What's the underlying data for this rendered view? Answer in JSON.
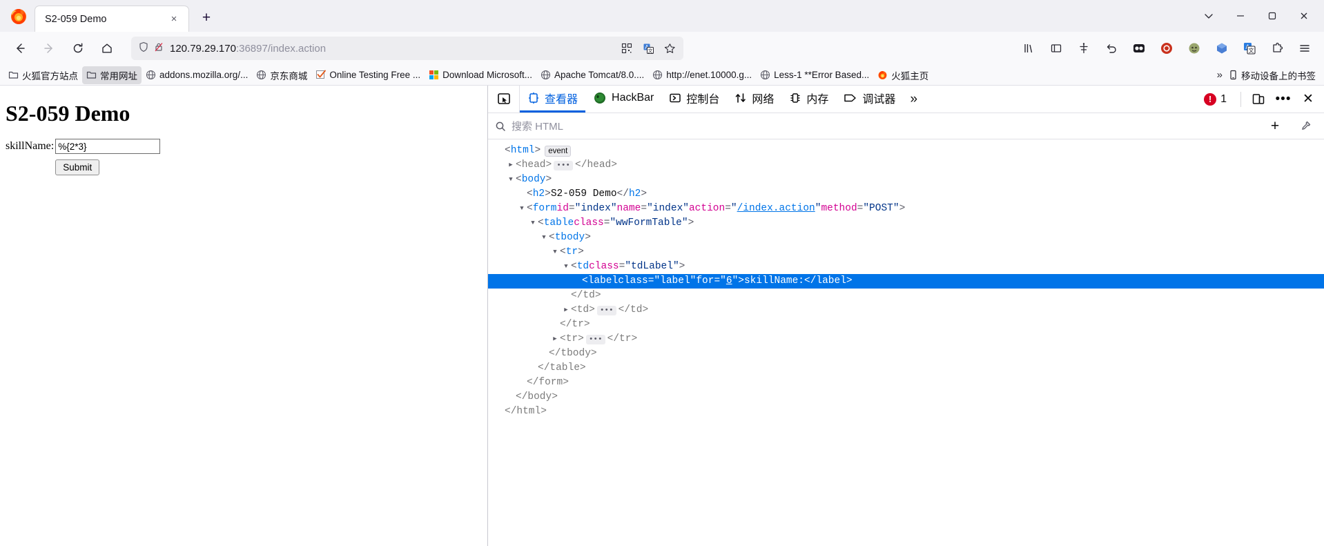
{
  "browser": {
    "tab": {
      "title": "S2-059 Demo",
      "close_label": "×"
    },
    "new_tab_label": "+",
    "window_controls": {
      "list_all_tabs": "list-all-tabs",
      "minimize": "minimize",
      "maximize": "maximize",
      "close": "close"
    },
    "nav": {
      "back": "back",
      "forward": "forward",
      "reload": "reload",
      "home": "home"
    },
    "urlbar": {
      "host": "120.79.29.170",
      "rest": ":36897/index.action",
      "shield": "shield-icon",
      "insecure": "insecure-lock-icon",
      "qr": "qr-icon",
      "translate": "translate-icon",
      "bookmark_star": "star-icon"
    },
    "toolbar_right": [
      "library-icon",
      "reader-icon",
      "container-icon",
      "undo-icon",
      "pocket-icon",
      "adblock-icon",
      "monkey-icon",
      "hex-icon",
      "translate2-icon",
      "extensions-icon",
      "menu-icon"
    ]
  },
  "bookmarks": {
    "items": [
      {
        "label": "火狐官方站点",
        "icon": "folder-icon",
        "selected": false
      },
      {
        "label": "常用网址",
        "icon": "folder-icon",
        "selected": true
      },
      {
        "label": "addons.mozilla.org/...",
        "icon": "globe-icon",
        "selected": false
      },
      {
        "label": "京东商城",
        "icon": "globe-icon",
        "selected": false
      },
      {
        "label": "Online Testing Free ...",
        "icon": "checkmark-icon",
        "selected": false
      },
      {
        "label": "Download Microsoft...",
        "icon": "microsoft-icon",
        "selected": false
      },
      {
        "label": "Apache Tomcat/8.0....",
        "icon": "globe-icon",
        "selected": false
      },
      {
        "label": "http://enet.10000.g...",
        "icon": "globe-icon",
        "selected": false
      },
      {
        "label": "Less-1 **Error Based...",
        "icon": "globe-icon",
        "selected": false
      },
      {
        "label": "火狐主页",
        "icon": "firefox-icon",
        "selected": false
      }
    ],
    "overflow_label": "»",
    "mobile": {
      "label": "移动设备上的书签",
      "icon": "mobile-icon"
    }
  },
  "page": {
    "heading": "S2-059 Demo",
    "form": {
      "label": "skillName:",
      "input_value": "%{2*3}",
      "input_placeholder": "",
      "submit_label": "Submit"
    }
  },
  "devtools": {
    "picker_icon": "element-picker-icon",
    "tabs": [
      {
        "label": "查看器",
        "icon": "inspector-icon",
        "active": true
      },
      {
        "label": "HackBar",
        "icon": "hackbar-icon",
        "active": false
      },
      {
        "label": "控制台",
        "icon": "console-icon",
        "active": false
      },
      {
        "label": "网络",
        "icon": "network-icon",
        "active": false
      },
      {
        "label": "内存",
        "icon": "memory-icon",
        "active": false
      },
      {
        "label": "调试器",
        "icon": "debugger-icon",
        "active": false
      }
    ],
    "overflow_label": "»",
    "error_count": "1",
    "responsive_icon": "responsive-design-mode-icon",
    "meatball_label": "•••",
    "close_label": "✕",
    "search": {
      "placeholder": "搜索 HTML",
      "icon": "search-icon",
      "add_node_label": "+",
      "eyedropper_icon": "eyedropper-icon"
    },
    "dom": {
      "badge_event": "event",
      "nodes": [
        {
          "indent": 0,
          "twisty": "none",
          "type": "open",
          "tag": "html",
          "badge": "event"
        },
        {
          "indent": 1,
          "twisty": "closed",
          "type": "collapsed",
          "tag": "head"
        },
        {
          "indent": 1,
          "twisty": "open",
          "type": "open",
          "tag": "body"
        },
        {
          "indent": 2,
          "twisty": "none",
          "type": "text-node",
          "tag": "h2",
          "text": "S2-059 Demo"
        },
        {
          "indent": 2,
          "twisty": "open",
          "type": "open",
          "tag": "form",
          "attrs": [
            {
              "name": "id",
              "value": "index"
            },
            {
              "name": "name",
              "value": "index"
            },
            {
              "name": "action",
              "value": "/index.action",
              "link": true
            },
            {
              "name": "method",
              "value": "POST"
            }
          ]
        },
        {
          "indent": 3,
          "twisty": "open",
          "type": "open",
          "tag": "table",
          "attrs": [
            {
              "name": "class",
              "value": "wwFormTable"
            }
          ]
        },
        {
          "indent": 4,
          "twisty": "open",
          "type": "open",
          "tag": "tbody"
        },
        {
          "indent": 5,
          "twisty": "open",
          "type": "open",
          "tag": "tr"
        },
        {
          "indent": 6,
          "twisty": "open",
          "type": "open",
          "tag": "td",
          "attrs": [
            {
              "name": "class",
              "value": "tdLabel"
            }
          ]
        },
        {
          "indent": 7,
          "twisty": "none",
          "type": "text-node",
          "tag": "label",
          "selected": true,
          "attrs": [
            {
              "name": "class",
              "value": "label"
            },
            {
              "name": "for",
              "value": "6",
              "link": true
            }
          ],
          "text": "skillName:"
        },
        {
          "indent": 6,
          "twisty": "none",
          "type": "close",
          "tag": "td"
        },
        {
          "indent": 6,
          "twisty": "closed",
          "type": "collapsed",
          "tag": "td"
        },
        {
          "indent": 5,
          "twisty": "none",
          "type": "close",
          "tag": "tr"
        },
        {
          "indent": 5,
          "twisty": "closed",
          "type": "collapsed",
          "tag": "tr"
        },
        {
          "indent": 4,
          "twisty": "none",
          "type": "close",
          "tag": "tbody"
        },
        {
          "indent": 3,
          "twisty": "none",
          "type": "close",
          "tag": "table"
        },
        {
          "indent": 2,
          "twisty": "none",
          "type": "close",
          "tag": "form"
        },
        {
          "indent": 1,
          "twisty": "none",
          "type": "close",
          "tag": "body"
        },
        {
          "indent": 0,
          "twisty": "none",
          "type": "close",
          "tag": "html"
        }
      ]
    }
  },
  "colors": {
    "accent": "#0060df",
    "selection": "#0074e8",
    "tag": "#0074e8",
    "attr": "#d30292",
    "error": "#d70022",
    "chrome_bg": "#f9f9fb"
  }
}
